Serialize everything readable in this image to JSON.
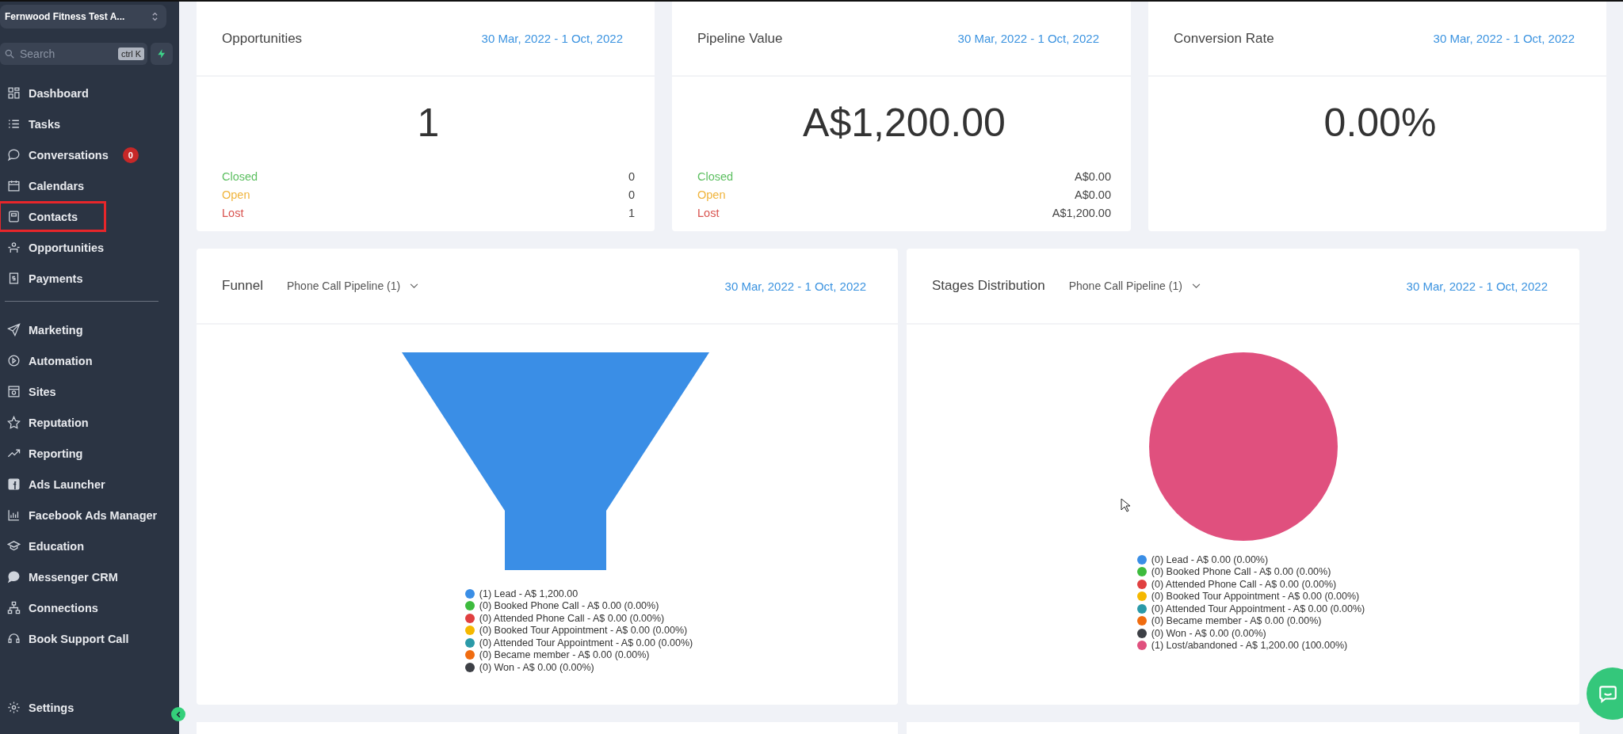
{
  "sidebar": {
    "account": "Fernwood Fitness Test A...",
    "search": {
      "placeholder": "Search",
      "shortcut": "ctrl K"
    },
    "items": [
      {
        "label": "Dashboard",
        "highlighted": false
      },
      {
        "label": "Tasks",
        "highlighted": false
      },
      {
        "label": "Conversations",
        "badge": "0",
        "highlighted": false
      },
      {
        "label": "Calendars",
        "highlighted": false
      },
      {
        "label": "Contacts",
        "highlighted": true
      },
      {
        "label": "Opportunities",
        "highlighted": false
      },
      {
        "label": "Payments",
        "highlighted": false
      }
    ],
    "items_2": [
      {
        "label": "Marketing",
        "highlighted": false
      },
      {
        "label": "Automation",
        "highlighted": false
      },
      {
        "label": "Sites",
        "highlighted": false
      },
      {
        "label": "Reputation",
        "highlighted": false
      },
      {
        "label": "Reporting",
        "highlighted": false
      },
      {
        "label": "Ads Launcher",
        "highlighted": false
      },
      {
        "label": "Facebook Ads Manager",
        "highlighted": false
      },
      {
        "label": "Education",
        "highlighted": false
      },
      {
        "label": "Messenger CRM",
        "highlighted": false
      },
      {
        "label": "Connections",
        "highlighted": false
      },
      {
        "label": "Book Support Call",
        "highlighted": false
      }
    ],
    "settings": {
      "label": "Settings",
      "highlighted": false
    }
  },
  "stat_cards": [
    {
      "title": "Opportunities",
      "date_range": "30 Mar, 2022 - 1 Oct, 2022",
      "value": "1",
      "rows": [
        {
          "kind": "closed",
          "label": "Closed",
          "value": "0"
        },
        {
          "kind": "open",
          "label": "Open",
          "value": "0"
        },
        {
          "kind": "lost",
          "label": "Lost",
          "value": "1"
        }
      ]
    },
    {
      "title": "Pipeline Value",
      "date_range": "30 Mar, 2022 - 1 Oct, 2022",
      "value": "A$1,200.00",
      "rows": [
        {
          "kind": "closed",
          "label": "Closed",
          "value": "A$0.00"
        },
        {
          "kind": "open",
          "label": "Open",
          "value": "A$0.00"
        },
        {
          "kind": "lost",
          "label": "Lost",
          "value": "A$1,200.00"
        }
      ]
    },
    {
      "title": "Conversion Rate",
      "date_range": "30 Mar, 2022 - 1 Oct, 2022",
      "value": "0.00%"
    }
  ],
  "chart_cards": [
    {
      "kind": "funnel",
      "title": "Funnel",
      "pipeline": "Phone Call Pipeline (1)",
      "date_range": "30 Mar, 2022 - 1 Oct, 2022",
      "legend": [
        {
          "text": "(1) Lead - A$ 1,200.00",
          "color": "#3a8ee6"
        },
        {
          "text": "(0) Booked Phone Call - A$ 0.00 (0.00%)",
          "color": "#3dbb3d"
        },
        {
          "text": "(0) Attended Phone Call - A$ 0.00 (0.00%)",
          "color": "#e04040"
        },
        {
          "text": "(0) Booked Tour Appointment - A$ 0.00 (0.00%)",
          "color": "#f5b800"
        },
        {
          "text": "(0) Attended Tour Appointment - A$ 0.00 (0.00%)",
          "color": "#2b9aa8"
        },
        {
          "text": "(0) Became member - A$ 0.00 (0.00%)",
          "color": "#f06c10"
        },
        {
          "text": "(0) Won - A$ 0.00 (0.00%)",
          "color": "#3d4046"
        }
      ]
    },
    {
      "kind": "pie",
      "title": "Stages Distribution",
      "pipeline": "Phone Call Pipeline (1)",
      "date_range": "30 Mar, 2022 - 1 Oct, 2022",
      "legend": [
        {
          "text": "(0) Lead - A$ 0.00 (0.00%)",
          "color": "#3a8ee6"
        },
        {
          "text": "(0) Booked Phone Call - A$ 0.00 (0.00%)",
          "color": "#3dbb3d"
        },
        {
          "text": "(0) Attended Phone Call - A$ 0.00 (0.00%)",
          "color": "#e04040"
        },
        {
          "text": "(0) Booked Tour Appointment - A$ 0.00 (0.00%)",
          "color": "#f5b800"
        },
        {
          "text": "(0) Attended Tour Appointment - A$ 0.00 (0.00%)",
          "color": "#2b9aa8"
        },
        {
          "text": "(0) Became member - A$ 0.00 (0.00%)",
          "color": "#f06c10"
        },
        {
          "text": "(0) Won - A$ 0.00 (0.00%)",
          "color": "#3d4046"
        },
        {
          "text": "(1) Lost/abandoned - A$ 1,200.00 (100.00%)",
          "color": "#e0507e"
        }
      ]
    }
  ]
}
